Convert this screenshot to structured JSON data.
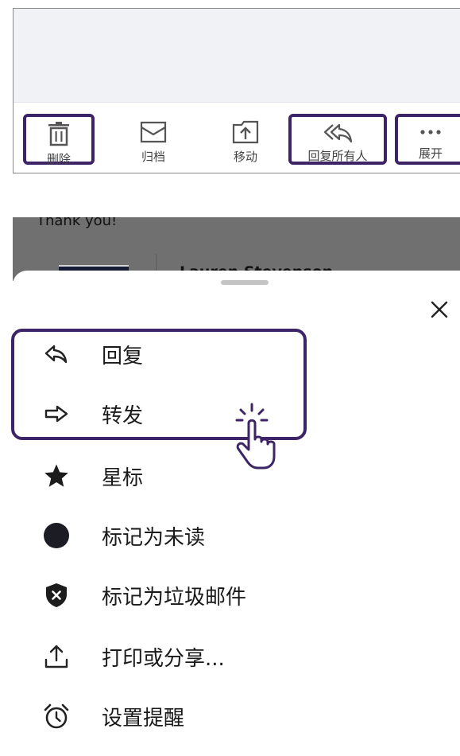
{
  "toolbar": {
    "items": [
      {
        "label": "删除",
        "icon": "trash-icon",
        "highlighted": true
      },
      {
        "label": "归档",
        "icon": "archive-icon",
        "highlighted": false
      },
      {
        "label": "移动",
        "icon": "move-icon",
        "highlighted": false
      },
      {
        "label": "回复所有人",
        "icon": "reply-all-icon",
        "highlighted": true
      },
      {
        "label": "展开",
        "icon": "more-icon",
        "highlighted": true
      }
    ]
  },
  "email": {
    "snippet": "Thank you!",
    "sender": "Lauren Stevenson"
  },
  "sheet": {
    "items": [
      {
        "label": "回复",
        "icon": "reply-icon"
      },
      {
        "label": "转发",
        "icon": "forward-icon"
      },
      {
        "label": "星标",
        "icon": "star-icon"
      },
      {
        "label": "标记为未读",
        "icon": "unread-dot-icon"
      },
      {
        "label": "标记为垃圾邮件",
        "icon": "spam-shield-icon"
      },
      {
        "label": "打印或分享...",
        "icon": "share-icon"
      },
      {
        "label": "设置提醒",
        "icon": "alarm-icon"
      }
    ]
  },
  "colors": {
    "highlight": "#3d2466",
    "icon": "#222222",
    "toolbar_icon": "#5a5a5a"
  }
}
